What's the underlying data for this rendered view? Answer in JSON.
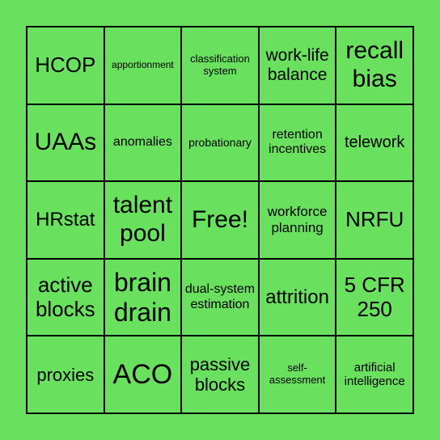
{
  "colors": {
    "background": "#69e15f",
    "border": "#000000"
  },
  "cells": [
    {
      "t": "HCOP",
      "s": 26
    },
    {
      "t": "apportionment",
      "s": 12
    },
    {
      "t": "classification system",
      "s": 13
    },
    {
      "t": "work-life balance",
      "s": 21
    },
    {
      "t": "recall bias",
      "s": 30
    },
    {
      "t": "UAAs",
      "s": 30
    },
    {
      "t": "anomalies",
      "s": 16
    },
    {
      "t": "probationary",
      "s": 14
    },
    {
      "t": "retention incentives",
      "s": 16
    },
    {
      "t": "telework",
      "s": 20
    },
    {
      "t": "HRstat",
      "s": 24
    },
    {
      "t": "talent pool",
      "s": 30
    },
    {
      "t": "Free!",
      "s": 30
    },
    {
      "t": "workforce planning",
      "s": 17
    },
    {
      "t": "NRFU",
      "s": 26
    },
    {
      "t": "active blocks",
      "s": 26
    },
    {
      "t": "brain drain",
      "s": 32
    },
    {
      "t": "dual-system estimation",
      "s": 16
    },
    {
      "t": "attrition",
      "s": 24
    },
    {
      "t": "5 CFR 250",
      "s": 26
    },
    {
      "t": "proxies",
      "s": 22
    },
    {
      "t": "ACO",
      "s": 34
    },
    {
      "t": "passive blocks",
      "s": 22
    },
    {
      "t": "self-assessment",
      "s": 13
    },
    {
      "t": "artificial intelligence",
      "s": 15
    }
  ]
}
